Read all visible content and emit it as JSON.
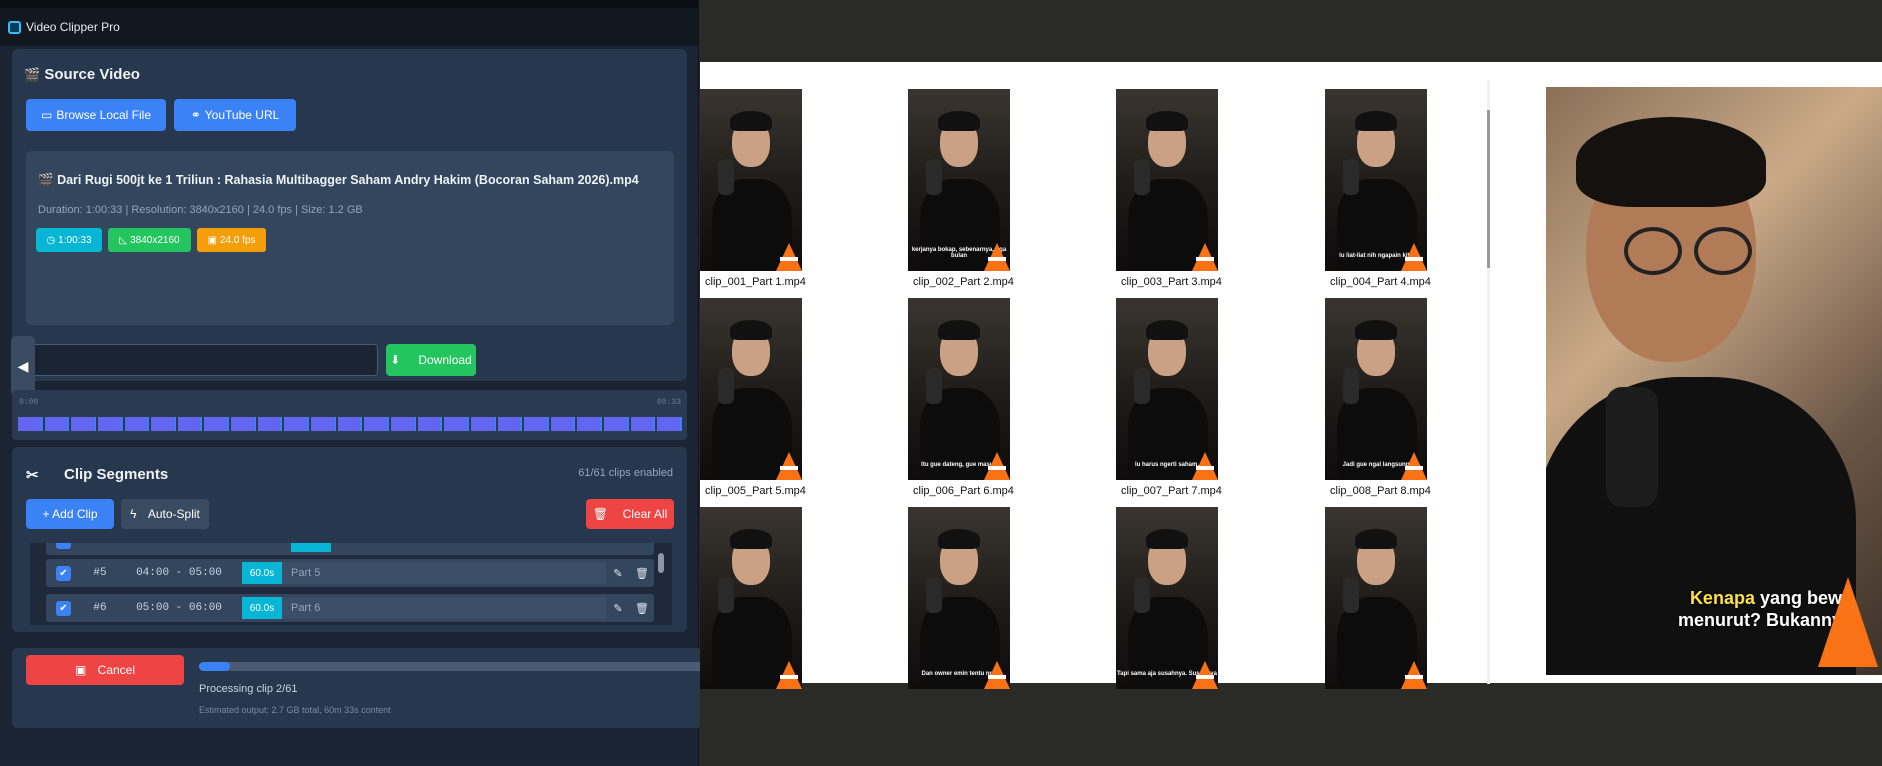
{
  "app": {
    "title": "Video Clipper Pro"
  },
  "source": {
    "heading": "Source Video",
    "browse_label": "Browse Local File",
    "youtube_label": "YouTube URL",
    "file_name": "Dari Rugi 500jt ke 1 Triliun :  Rahasia Multibagger Saham Andry Hakim (Bocoran Saham 2026).mp4",
    "meta": "Duration: 1:00:33  |  Resolution: 3840x2160  |  24.0 fps  |  Size: 1.2 GB",
    "tags": [
      {
        "label": "1:00:33",
        "icon": "clock-icon",
        "color": "#06b6d4"
      },
      {
        "label": "3840x2160",
        "icon": "resolution-icon",
        "color": "#22c55e"
      },
      {
        "label": "24.0 fps",
        "icon": "film-icon",
        "color": "#f59e0b"
      }
    ],
    "url_value": "",
    "download_label": "Download"
  },
  "timeline": {
    "start": "0:00",
    "end": "60:33"
  },
  "segments": {
    "heading": "Clip Segments",
    "status": "61/61 clips enabled",
    "add_label": "+ Add Clip",
    "autosplit_label": "Auto-Split",
    "clear_label": "Clear All",
    "rows": [
      {
        "num": "#5",
        "range": "04:00 - 05:00",
        "dur": "60.0s",
        "name": "Part 5"
      },
      {
        "num": "#6",
        "range": "05:00 - 06:00",
        "dur": "60.0s",
        "name": "Part 6"
      }
    ]
  },
  "progress": {
    "cancel_label": "Cancel",
    "status": "Processing clip 2/61",
    "estimate": "Estimated output: 2.7 GB total, 60m 33s content",
    "fraction": 0.06
  },
  "explorer": {
    "files": [
      {
        "name": "clip_001_Part 1.mp4",
        "caption": ""
      },
      {
        "name": "clip_002_Part 2.mp4",
        "caption": "kerjanya bokap, sebenarnya, tiga bulan"
      },
      {
        "name": "clip_003_Part 3.mp4",
        "caption": ""
      },
      {
        "name": "clip_004_Part 4.mp4",
        "caption": "lu liat-liat nih ngapain kita"
      },
      {
        "name": "clip_005_Part 5.mp4",
        "caption": ""
      },
      {
        "name": "clip_006_Part 6.mp4",
        "caption": "Itu gue dateng, gue masuk"
      },
      {
        "name": "clip_007_Part 7.mp4",
        "caption": "lu harus ngerti saham,"
      },
      {
        "name": "clip_008_Part 8.mp4",
        "caption": "Jadi gue ngal langsung"
      },
      {
        "name": "",
        "caption": ""
      },
      {
        "name": "",
        "caption": "Dan owner emin tentu nge"
      },
      {
        "name": "",
        "caption": "Tapi sama aja susahnya. Susahnya"
      },
      {
        "name": "",
        "caption": ""
      }
    ]
  },
  "preview": {
    "caption_highlight": "Kenapa",
    "caption_line1": " yang bewa",
    "caption_line2": "menurut? Bukannya"
  }
}
